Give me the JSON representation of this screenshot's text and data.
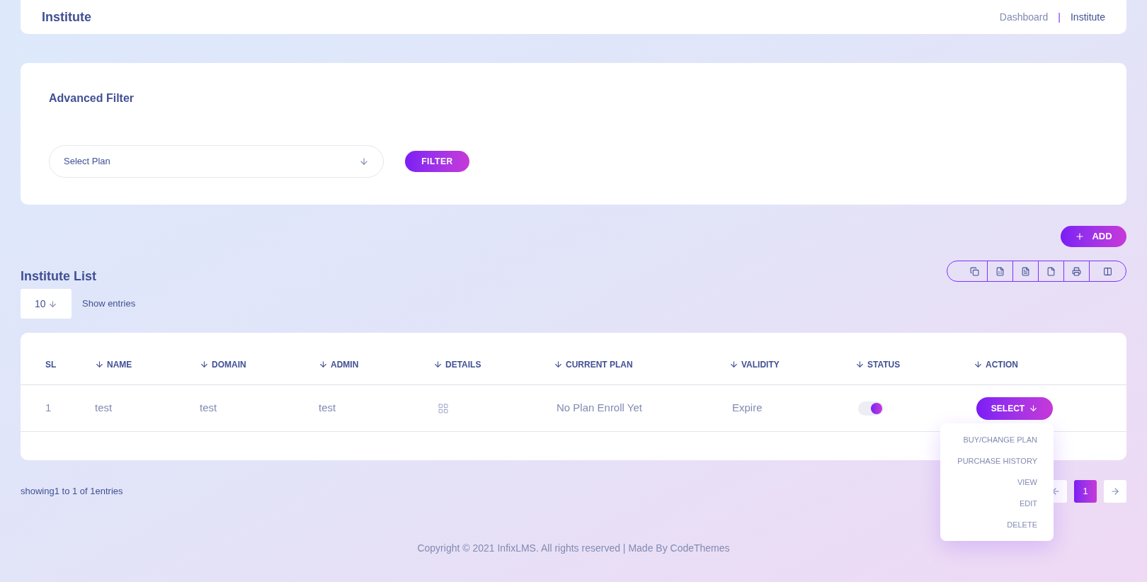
{
  "header": {
    "title": "Institute",
    "breadcrumbs": [
      {
        "label": "Dashboard",
        "selected": false
      },
      {
        "label": "Institute",
        "selected": true
      }
    ],
    "separator": "|"
  },
  "filter": {
    "title": "Advanced Filter",
    "select": {
      "placeholder": "Select Plan"
    },
    "button": "FILTER"
  },
  "add_button": "ADD",
  "export_buttons": [
    {
      "kind": "copy"
    },
    {
      "kind": "excel"
    },
    {
      "kind": "csv"
    },
    {
      "kind": "pdf"
    },
    {
      "kind": "print"
    },
    {
      "kind": "columns"
    }
  ],
  "list": {
    "title": "Institute List",
    "page_size": "10",
    "page_size_label": "Show entries"
  },
  "table": {
    "columns": [
      {
        "label": "SL",
        "sortable": false
      },
      {
        "label": "NAME",
        "sortable": true
      },
      {
        "label": "DOMAIN",
        "sortable": true
      },
      {
        "label": "ADMIN",
        "sortable": true
      },
      {
        "label": "DETAILS",
        "sortable": true
      },
      {
        "label": "CURRENT PLAN",
        "sortable": true
      },
      {
        "label": "VALIDITY",
        "sortable": true
      },
      {
        "label": "STATUS",
        "sortable": true
      },
      {
        "label": "ACTION",
        "sortable": true
      }
    ],
    "rows": [
      {
        "sl": "1",
        "name": "test",
        "domain": "test",
        "admin": "test",
        "current_plan": "No Plan Enroll Yet",
        "validity": "Expire",
        "status_on": true,
        "action": "SELECT"
      }
    ]
  },
  "action_menu": [
    "BUY/CHANGE PLAN",
    "PURCHASE HISTORY",
    "VIEW",
    "EDIT",
    "DELETE"
  ],
  "summary": "showing1 to 1 of 1entries",
  "pagination": [
    {
      "label": "1",
      "selected": true
    }
  ],
  "footer": "Copyright © 2021 InfixLMS. All rights reserved | Made By CodeThemes"
}
